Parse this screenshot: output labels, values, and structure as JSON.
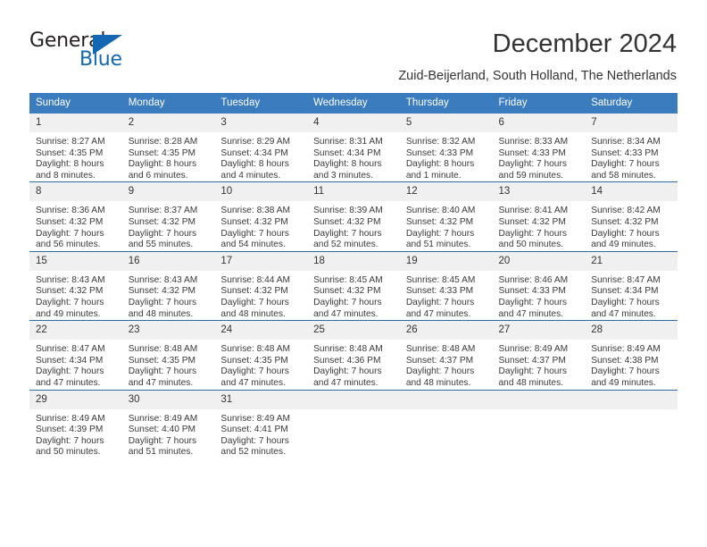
{
  "brand": {
    "name_top": "General",
    "name_bottom": "Blue",
    "triangle_color": "#1268b3",
    "text_color": "#231f20"
  },
  "header": {
    "title": "December 2024",
    "subtitle": "Zuid-Beijerland, South Holland, The Netherlands"
  },
  "theme": {
    "header_blue": "#3a7cbe",
    "row_divider_blue": "#2e6da4",
    "daynum_band": "#f0f0f0",
    "text": "#333333"
  },
  "calendar": {
    "weekday_headers": [
      "Sunday",
      "Monday",
      "Tuesday",
      "Wednesday",
      "Thursday",
      "Friday",
      "Saturday"
    ],
    "weeks": [
      [
        {
          "day": "1",
          "sunrise": "Sunrise: 8:27 AM",
          "sunset": "Sunset: 4:35 PM",
          "daylight_line1": "Daylight: 8 hours",
          "daylight_line2": "and 8 minutes."
        },
        {
          "day": "2",
          "sunrise": "Sunrise: 8:28 AM",
          "sunset": "Sunset: 4:35 PM",
          "daylight_line1": "Daylight: 8 hours",
          "daylight_line2": "and 6 minutes."
        },
        {
          "day": "3",
          "sunrise": "Sunrise: 8:29 AM",
          "sunset": "Sunset: 4:34 PM",
          "daylight_line1": "Daylight: 8 hours",
          "daylight_line2": "and 4 minutes."
        },
        {
          "day": "4",
          "sunrise": "Sunrise: 8:31 AM",
          "sunset": "Sunset: 4:34 PM",
          "daylight_line1": "Daylight: 8 hours",
          "daylight_line2": "and 3 minutes."
        },
        {
          "day": "5",
          "sunrise": "Sunrise: 8:32 AM",
          "sunset": "Sunset: 4:33 PM",
          "daylight_line1": "Daylight: 8 hours",
          "daylight_line2": "and 1 minute."
        },
        {
          "day": "6",
          "sunrise": "Sunrise: 8:33 AM",
          "sunset": "Sunset: 4:33 PM",
          "daylight_line1": "Daylight: 7 hours",
          "daylight_line2": "and 59 minutes."
        },
        {
          "day": "7",
          "sunrise": "Sunrise: 8:34 AM",
          "sunset": "Sunset: 4:33 PM",
          "daylight_line1": "Daylight: 7 hours",
          "daylight_line2": "and 58 minutes."
        }
      ],
      [
        {
          "day": "8",
          "sunrise": "Sunrise: 8:36 AM",
          "sunset": "Sunset: 4:32 PM",
          "daylight_line1": "Daylight: 7 hours",
          "daylight_line2": "and 56 minutes."
        },
        {
          "day": "9",
          "sunrise": "Sunrise: 8:37 AM",
          "sunset": "Sunset: 4:32 PM",
          "daylight_line1": "Daylight: 7 hours",
          "daylight_line2": "and 55 minutes."
        },
        {
          "day": "10",
          "sunrise": "Sunrise: 8:38 AM",
          "sunset": "Sunset: 4:32 PM",
          "daylight_line1": "Daylight: 7 hours",
          "daylight_line2": "and 54 minutes."
        },
        {
          "day": "11",
          "sunrise": "Sunrise: 8:39 AM",
          "sunset": "Sunset: 4:32 PM",
          "daylight_line1": "Daylight: 7 hours",
          "daylight_line2": "and 52 minutes."
        },
        {
          "day": "12",
          "sunrise": "Sunrise: 8:40 AM",
          "sunset": "Sunset: 4:32 PM",
          "daylight_line1": "Daylight: 7 hours",
          "daylight_line2": "and 51 minutes."
        },
        {
          "day": "13",
          "sunrise": "Sunrise: 8:41 AM",
          "sunset": "Sunset: 4:32 PM",
          "daylight_line1": "Daylight: 7 hours",
          "daylight_line2": "and 50 minutes."
        },
        {
          "day": "14",
          "sunrise": "Sunrise: 8:42 AM",
          "sunset": "Sunset: 4:32 PM",
          "daylight_line1": "Daylight: 7 hours",
          "daylight_line2": "and 49 minutes."
        }
      ],
      [
        {
          "day": "15",
          "sunrise": "Sunrise: 8:43 AM",
          "sunset": "Sunset: 4:32 PM",
          "daylight_line1": "Daylight: 7 hours",
          "daylight_line2": "and 49 minutes."
        },
        {
          "day": "16",
          "sunrise": "Sunrise: 8:43 AM",
          "sunset": "Sunset: 4:32 PM",
          "daylight_line1": "Daylight: 7 hours",
          "daylight_line2": "and 48 minutes."
        },
        {
          "day": "17",
          "sunrise": "Sunrise: 8:44 AM",
          "sunset": "Sunset: 4:32 PM",
          "daylight_line1": "Daylight: 7 hours",
          "daylight_line2": "and 48 minutes."
        },
        {
          "day": "18",
          "sunrise": "Sunrise: 8:45 AM",
          "sunset": "Sunset: 4:32 PM",
          "daylight_line1": "Daylight: 7 hours",
          "daylight_line2": "and 47 minutes."
        },
        {
          "day": "19",
          "sunrise": "Sunrise: 8:45 AM",
          "sunset": "Sunset: 4:33 PM",
          "daylight_line1": "Daylight: 7 hours",
          "daylight_line2": "and 47 minutes."
        },
        {
          "day": "20",
          "sunrise": "Sunrise: 8:46 AM",
          "sunset": "Sunset: 4:33 PM",
          "daylight_line1": "Daylight: 7 hours",
          "daylight_line2": "and 47 minutes."
        },
        {
          "day": "21",
          "sunrise": "Sunrise: 8:47 AM",
          "sunset": "Sunset: 4:34 PM",
          "daylight_line1": "Daylight: 7 hours",
          "daylight_line2": "and 47 minutes."
        }
      ],
      [
        {
          "day": "22",
          "sunrise": "Sunrise: 8:47 AM",
          "sunset": "Sunset: 4:34 PM",
          "daylight_line1": "Daylight: 7 hours",
          "daylight_line2": "and 47 minutes."
        },
        {
          "day": "23",
          "sunrise": "Sunrise: 8:48 AM",
          "sunset": "Sunset: 4:35 PM",
          "daylight_line1": "Daylight: 7 hours",
          "daylight_line2": "and 47 minutes."
        },
        {
          "day": "24",
          "sunrise": "Sunrise: 8:48 AM",
          "sunset": "Sunset: 4:35 PM",
          "daylight_line1": "Daylight: 7 hours",
          "daylight_line2": "and 47 minutes."
        },
        {
          "day": "25",
          "sunrise": "Sunrise: 8:48 AM",
          "sunset": "Sunset: 4:36 PM",
          "daylight_line1": "Daylight: 7 hours",
          "daylight_line2": "and 47 minutes."
        },
        {
          "day": "26",
          "sunrise": "Sunrise: 8:48 AM",
          "sunset": "Sunset: 4:37 PM",
          "daylight_line1": "Daylight: 7 hours",
          "daylight_line2": "and 48 minutes."
        },
        {
          "day": "27",
          "sunrise": "Sunrise: 8:49 AM",
          "sunset": "Sunset: 4:37 PM",
          "daylight_line1": "Daylight: 7 hours",
          "daylight_line2": "and 48 minutes."
        },
        {
          "day": "28",
          "sunrise": "Sunrise: 8:49 AM",
          "sunset": "Sunset: 4:38 PM",
          "daylight_line1": "Daylight: 7 hours",
          "daylight_line2": "and 49 minutes."
        }
      ],
      [
        {
          "day": "29",
          "sunrise": "Sunrise: 8:49 AM",
          "sunset": "Sunset: 4:39 PM",
          "daylight_line1": "Daylight: 7 hours",
          "daylight_line2": "and 50 minutes."
        },
        {
          "day": "30",
          "sunrise": "Sunrise: 8:49 AM",
          "sunset": "Sunset: 4:40 PM",
          "daylight_line1": "Daylight: 7 hours",
          "daylight_line2": "and 51 minutes."
        },
        {
          "day": "31",
          "sunrise": "Sunrise: 8:49 AM",
          "sunset": "Sunset: 4:41 PM",
          "daylight_line1": "Daylight: 7 hours",
          "daylight_line2": "and 52 minutes."
        },
        {
          "day": "",
          "sunrise": "",
          "sunset": "",
          "daylight_line1": "",
          "daylight_line2": ""
        },
        {
          "day": "",
          "sunrise": "",
          "sunset": "",
          "daylight_line1": "",
          "daylight_line2": ""
        },
        {
          "day": "",
          "sunrise": "",
          "sunset": "",
          "daylight_line1": "",
          "daylight_line2": ""
        },
        {
          "day": "",
          "sunrise": "",
          "sunset": "",
          "daylight_line1": "",
          "daylight_line2": ""
        }
      ]
    ]
  }
}
